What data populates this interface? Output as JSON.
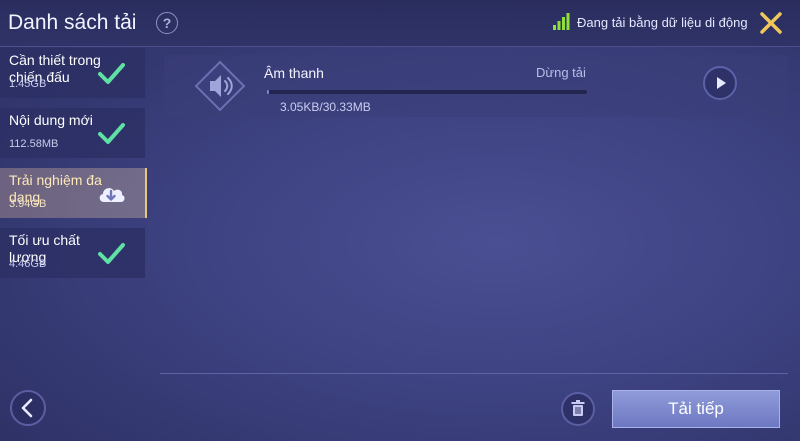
{
  "header": {
    "title": "Danh sách tải",
    "help_icon": "?",
    "network_status": "Đang tải bằng dữ liệu di động",
    "signal_color": "#8fe03a"
  },
  "categories": [
    {
      "name": "Cần thiết trong chiến đấu",
      "size": "1.45GB",
      "state": "done"
    },
    {
      "name": "Nội dung mới",
      "size": "112.58MB",
      "state": "done"
    },
    {
      "name": "Trải nghiệm đa dạng",
      "size": "3.94GB",
      "state": "downloading"
    },
    {
      "name": "Tối ưu chất lượng",
      "size": "4.46GB",
      "state": "done"
    }
  ],
  "download_item": {
    "name": "Âm thanh",
    "status": "Dừng tải",
    "size_progress": "3.05KB/30.33MB",
    "progress_fraction": 0.0001
  },
  "footer": {
    "continue_label": "Tải tiếp"
  },
  "colors": {
    "check": "#5fe0a5",
    "accent_gold": "#e7c77a"
  }
}
